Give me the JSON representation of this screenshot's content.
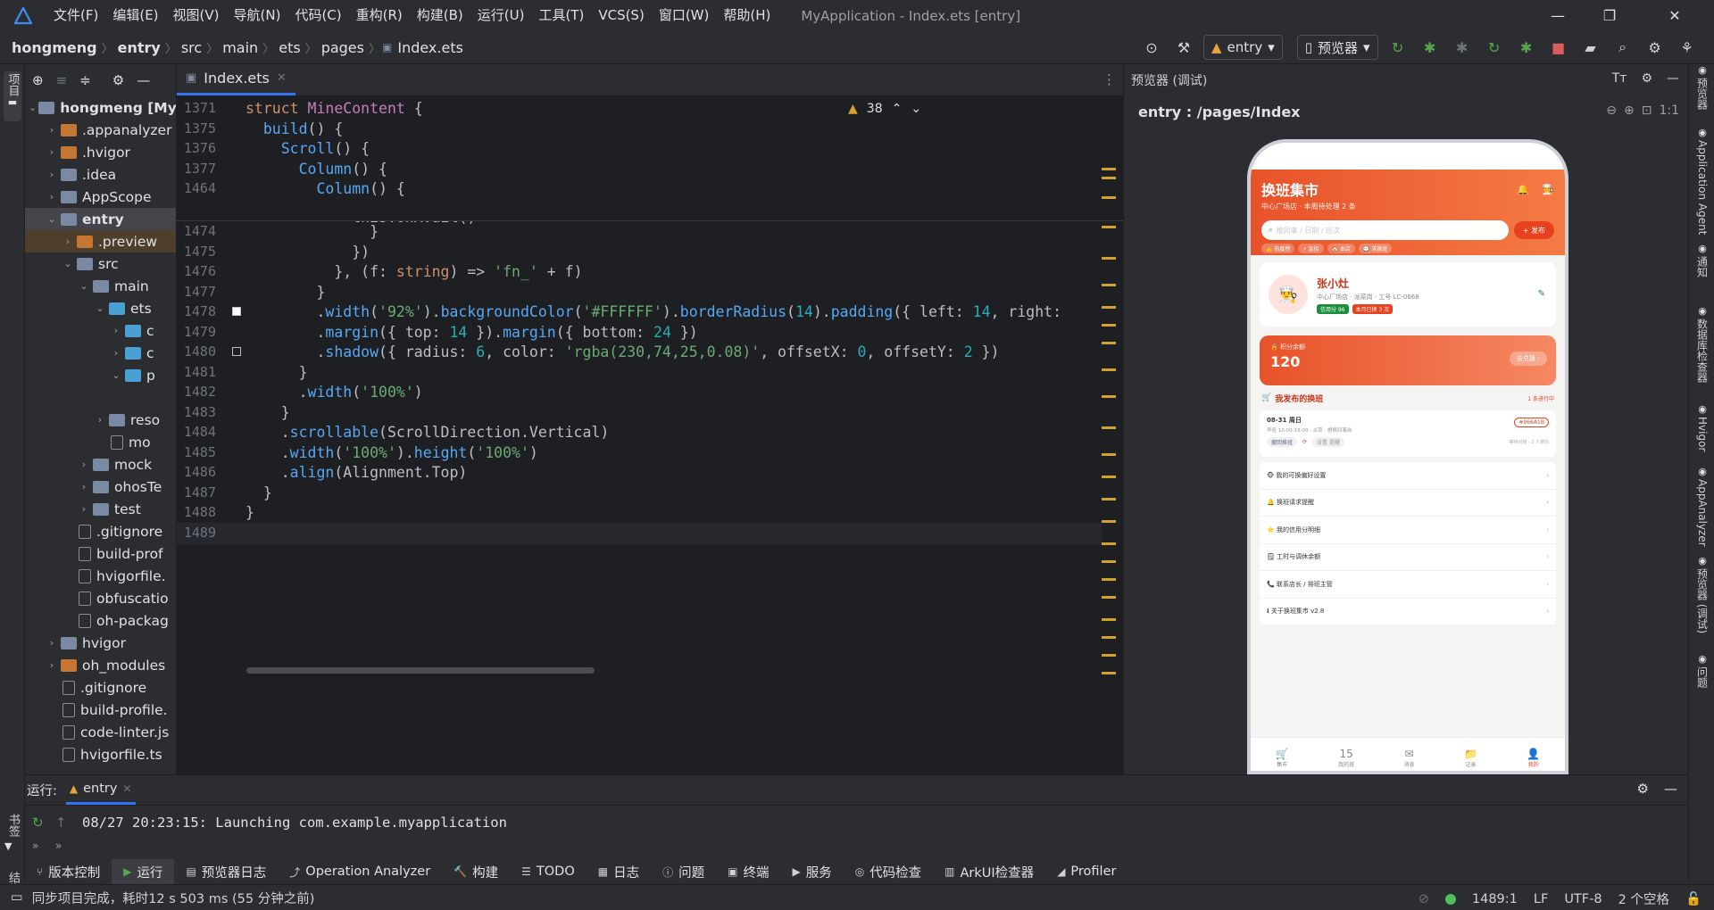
{
  "menu": {
    "items": [
      "文件(F)",
      "编辑(E)",
      "视图(V)",
      "导航(N)",
      "代码(C)",
      "重构(R)",
      "构建(B)",
      "运行(U)",
      "工具(T)",
      "VCS(S)",
      "窗口(W)",
      "帮助(H)"
    ],
    "window_title": "MyApplication - Index.ets [entry]"
  },
  "breadcrumb": [
    "hongmeng",
    "entry",
    "src",
    "main",
    "ets",
    "pages",
    "Index.ets"
  ],
  "toolbar": {
    "run_config": "entry",
    "device": "预览器"
  },
  "left_strip": {
    "project_label": "项目",
    "bookmarks_label": "书签",
    "structure_label": "结构"
  },
  "project_tree": [
    {
      "label": "hongmeng [My",
      "indent": 0,
      "arrow": "⌄",
      "type": "b",
      "bold": true
    },
    {
      "label": ".appanalyzer",
      "indent": 1,
      "arrow": "›",
      "type": "o"
    },
    {
      "label": ".hvigor",
      "indent": 1,
      "arrow": "›",
      "type": "o"
    },
    {
      "label": ".idea",
      "indent": 1,
      "arrow": "›",
      "type": "b"
    },
    {
      "label": "AppScope",
      "indent": 1,
      "arrow": "›",
      "type": "b"
    },
    {
      "label": "entry",
      "indent": 1,
      "arrow": "⌄",
      "type": "b",
      "bold": true
    },
    {
      "label": ".preview",
      "indent": 2,
      "arrow": "›",
      "type": "o"
    },
    {
      "label": "src",
      "indent": 2,
      "arrow": "⌄",
      "type": "b"
    },
    {
      "label": "main",
      "indent": 3,
      "arrow": "⌄",
      "type": "b"
    },
    {
      "label": "ets",
      "indent": 4,
      "arrow": "⌄",
      "type": "c"
    },
    {
      "label": "c",
      "indent": 5,
      "arrow": "›",
      "type": "c"
    },
    {
      "label": "c",
      "indent": 5,
      "arrow": "›",
      "type": "c"
    },
    {
      "label": "p",
      "indent": 5,
      "arrow": "⌄",
      "type": "c"
    },
    {
      "label": "",
      "indent": 6,
      "arrow": "",
      "type": "none"
    },
    {
      "label": "reso",
      "indent": 4,
      "arrow": "›",
      "type": "b"
    },
    {
      "label": "mo",
      "indent": 4,
      "arrow": "",
      "type": "file"
    },
    {
      "label": "mock",
      "indent": 3,
      "arrow": "›",
      "type": "b"
    },
    {
      "label": "ohosTe",
      "indent": 3,
      "arrow": "›",
      "type": "b"
    },
    {
      "label": "test",
      "indent": 3,
      "arrow": "›",
      "type": "b"
    },
    {
      "label": ".gitignore",
      "indent": 2,
      "arrow": "",
      "type": "file"
    },
    {
      "label": "build-prof",
      "indent": 2,
      "arrow": "",
      "type": "file"
    },
    {
      "label": "hvigorfile.",
      "indent": 2,
      "arrow": "",
      "type": "file"
    },
    {
      "label": "obfuscatio",
      "indent": 2,
      "arrow": "",
      "type": "file"
    },
    {
      "label": "oh-packag",
      "indent": 2,
      "arrow": "",
      "type": "file"
    },
    {
      "label": "hvigor",
      "indent": 1,
      "arrow": "›",
      "type": "b"
    },
    {
      "label": "oh_modules",
      "indent": 1,
      "arrow": "›",
      "type": "o"
    },
    {
      "label": ".gitignore",
      "indent": 1,
      "arrow": "",
      "type": "file"
    },
    {
      "label": "build-profile.",
      "indent": 1,
      "arrow": "",
      "type": "file"
    },
    {
      "label": "code-linter.js",
      "indent": 1,
      "arrow": "",
      "type": "file"
    },
    {
      "label": "hvigorfile.ts",
      "indent": 1,
      "arrow": "",
      "type": "file"
    }
  ],
  "editor": {
    "tab": "Index.ets",
    "warnings": "38",
    "sticky_lines": [
      {
        "n": "1371",
        "html": "<span class='kw'>struct</span> <span class='ty'>MineContent</span> {"
      },
      {
        "n": "1375",
        "html": "  <span class='fn'>build</span>() {"
      },
      {
        "n": "1376",
        "html": "    <span class='fn'>Scroll</span>() {"
      },
      {
        "n": "1377",
        "html": "      <span class='fn'>Column</span>() {"
      },
      {
        "n": "1464",
        "html": "        <span class='fn'>Column</span>() {"
      }
    ],
    "lines": [
      {
        "n": "1474",
        "html": "              }"
      },
      {
        "n": "1475",
        "html": "            })"
      },
      {
        "n": "1476",
        "html": "          }, (f: <span class='kw'>string</span>) => <span class='st'>'fn_'</span> + f)"
      },
      {
        "n": "1477",
        "html": "        }"
      },
      {
        "n": "1478",
        "html": "        .<span class='fn'>width</span>(<span class='st'>'92%'</span>).<span class='fn'>backgroundColor</span>(<span class='st'>'#FFFFFF'</span>).<span class='fn'>borderRadius</span>(<span class='nm'>14</span>).<span class='fn'>padding</span>({ left: <span class='nm'>14</span>, right:"
      },
      {
        "n": "1479",
        "html": "        .<span class='fn'>margin</span>({ top: <span class='nm'>14</span> }).<span class='fn'>margin</span>({ bottom: <span class='nm'>24</span> })"
      },
      {
        "n": "1480",
        "html": "        .<span class='fn'>shadow</span>({ radius: <span class='nm'>6</span>, color: <span class='st'>'rgba(230,74,25,0.08)'</span>, offsetX: <span class='nm'>0</span>, offsetY: <span class='nm'>2</span> })"
      },
      {
        "n": "1481",
        "html": "      }"
      },
      {
        "n": "1482",
        "html": "      .<span class='fn'>width</span>(<span class='st'>'100%'</span>)"
      },
      {
        "n": "1483",
        "html": "    }"
      },
      {
        "n": "1484",
        "html": "    .<span class='fn'>scrollable</span>(ScrollDirection.Vertical)"
      },
      {
        "n": "1485",
        "html": "    .<span class='fn'>width</span>(<span class='st'>'100%'</span>).<span class='fn'>height</span>(<span class='st'>'100%'</span>)"
      },
      {
        "n": "1486",
        "html": "    .<span class='fn'>align</span>(Alignment.Top)"
      },
      {
        "n": "1487",
        "html": "  }"
      },
      {
        "n": "1488",
        "html": "}"
      },
      {
        "n": "1489",
        "html": ""
      }
    ],
    "partial_line": "            this.onAvail()"
  },
  "preview": {
    "header": "预览器 (调试)",
    "route": "entry : /pages/Index",
    "zoom_label": "1:1"
  },
  "right_strip": [
    "预览器",
    "Application Agent",
    "通知",
    "数据库检查器",
    "Hvigor",
    "AppAnalyzer",
    "预览器 (调试)",
    "问题"
  ],
  "app": {
    "title": "换班集市",
    "subtitle": "中心广场店 · 本周待处理 2 条",
    "search_placeholder": "搜同事 / 日期 / 班次",
    "post_button": "+ 发布",
    "chips": [
      "👍 热度榜",
      "⚡ 急招",
      "🏠 本店",
      "💬 求换班"
    ],
    "profile": {
      "name": "张小灶",
      "info": "中心厂场店 · 派菜岗 · 工号 LC-0668",
      "badge1": "信用分 96",
      "badge2": "本月已换 3 次"
    },
    "points": {
      "label": "🔒 积分余额",
      "value": "120",
      "button": "去兑换 ›"
    },
    "my_posts": {
      "title": "我发布的换班",
      "count": "1 条进行中"
    },
    "post_card": {
      "date": "08-31 周日",
      "detail": "早班 10:00-18:00 · 派菜 · 想换同事岗",
      "tag": "#966A1B",
      "btn1": "撤回换班",
      "btn2": "设置 提醒",
      "note": "等待对接 · 2 人意向"
    },
    "menu_items": [
      "🐵 我的可换偏好设置",
      "🔔 换班请求提醒",
      "⭐ 我的信用分明细",
      "🗒 工时与调休余额",
      "📞 联系店长 / 排班主管",
      "ℹ 关于换班集市 v2.8"
    ],
    "tabbar": [
      {
        "icon": "🛒",
        "label": "集市"
      },
      {
        "icon": "15",
        "label": "我的班"
      },
      {
        "icon": "✉",
        "label": "消息"
      },
      {
        "icon": "📁",
        "label": "记录"
      },
      {
        "icon": "👤",
        "label": "我的"
      }
    ]
  },
  "run_panel": {
    "label": "运行:",
    "tab": "entry",
    "log": "08/27 20:23:15: Launching com.example.myapplication"
  },
  "bottom_tools": [
    {
      "icon": "⑂",
      "label": "版本控制"
    },
    {
      "icon": "▶",
      "label": "运行"
    },
    {
      "icon": "▤",
      "label": "预览器日志"
    },
    {
      "icon": "⤴",
      "label": "Operation Analyzer"
    },
    {
      "icon": "🔨",
      "label": "构建"
    },
    {
      "icon": "☰",
      "label": "TODO"
    },
    {
      "icon": "▦",
      "label": "日志"
    },
    {
      "icon": "ⓘ",
      "label": "问题"
    },
    {
      "icon": "▣",
      "label": "终端"
    },
    {
      "icon": "▶",
      "label": "服务"
    },
    {
      "icon": "◎",
      "label": "代码检查"
    },
    {
      "icon": "▥",
      "label": "ArkUI检查器"
    },
    {
      "icon": "◢",
      "label": "Profiler"
    }
  ],
  "status": {
    "message": "同步项目完成，耗时12 s 503 ms (55 分钟之前)",
    "position": "1489:1",
    "line_sep": "LF",
    "encoding": "UTF-8",
    "indent": "2 个空格"
  },
  "colors": {
    "accent": "#3574f0",
    "app_orange": "#e8522a",
    "warning": "#d6a02c"
  }
}
